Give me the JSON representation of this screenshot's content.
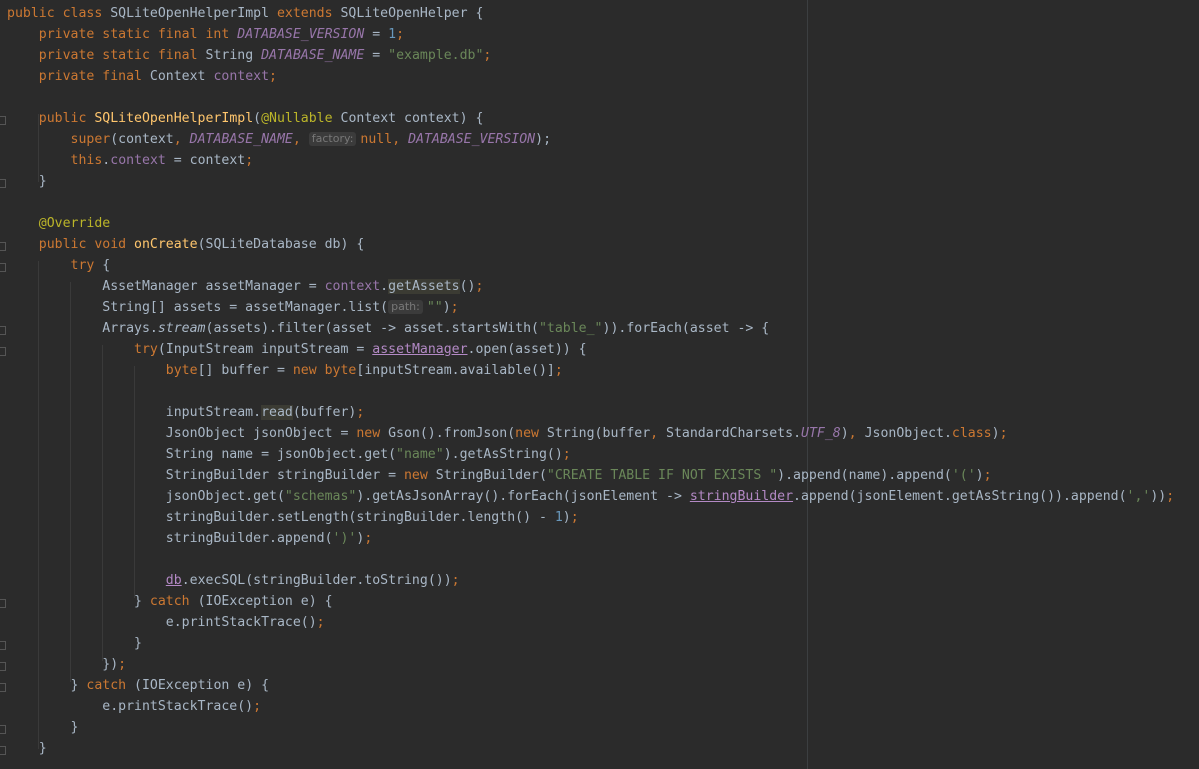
{
  "editor": {
    "lines": [
      [
        {
          "t": "public class ",
          "c": "kw"
        },
        {
          "t": "SQLiteOpenHelperImpl "
        },
        {
          "t": "extends ",
          "c": "kw"
        },
        {
          "t": "SQLiteOpenHelper {"
        }
      ],
      [
        {
          "t": "    "
        },
        {
          "t": "private static final int ",
          "c": "kw"
        },
        {
          "t": "DATABASE_VERSION",
          "c": "cst"
        },
        {
          "t": " = "
        },
        {
          "t": "1",
          "c": "num"
        },
        {
          "t": ";",
          "c": "kw"
        }
      ],
      [
        {
          "t": "    "
        },
        {
          "t": "private static final ",
          "c": "kw"
        },
        {
          "t": "String "
        },
        {
          "t": "DATABASE_NAME",
          "c": "cst"
        },
        {
          "t": " = "
        },
        {
          "t": "\"example.db\"",
          "c": "str"
        },
        {
          "t": ";",
          "c": "kw"
        }
      ],
      [
        {
          "t": "    "
        },
        {
          "t": "private final ",
          "c": "kw"
        },
        {
          "t": "Context "
        },
        {
          "t": "context",
          "c": "fld"
        },
        {
          "t": ";",
          "c": "kw"
        }
      ],
      [],
      [
        {
          "t": "    "
        },
        {
          "t": "public ",
          "c": "kw"
        },
        {
          "t": "SQLiteOpenHelperImpl",
          "c": "fn"
        },
        {
          "t": "("
        },
        {
          "t": "@Nullable ",
          "c": "ann"
        },
        {
          "t": "Context context) {"
        }
      ],
      [
        {
          "t": "        "
        },
        {
          "t": "super",
          "c": "kw"
        },
        {
          "t": "(context"
        },
        {
          "t": ", ",
          "c": "kw"
        },
        {
          "t": "DATABASE_NAME",
          "c": "cst"
        },
        {
          "t": ", ",
          "c": "kw"
        },
        {
          "t": "factory:",
          "c": "hint"
        },
        {
          "t": "null",
          "c": "kw"
        },
        {
          "t": ", ",
          "c": "kw"
        },
        {
          "t": "DATABASE_VERSION",
          "c": "cst"
        },
        {
          "t": ");"
        }
      ],
      [
        {
          "t": "        "
        },
        {
          "t": "this",
          "c": "kw"
        },
        {
          "t": "."
        },
        {
          "t": "context",
          "c": "fld"
        },
        {
          "t": " = context"
        },
        {
          "t": ";",
          "c": "kw"
        }
      ],
      [
        {
          "t": "    }"
        }
      ],
      [],
      [
        {
          "t": "    "
        },
        {
          "t": "@Override",
          "c": "ann"
        }
      ],
      [
        {
          "t": "    "
        },
        {
          "t": "public void ",
          "c": "kw"
        },
        {
          "t": "onCreate",
          "c": "fn"
        },
        {
          "t": "(SQLiteDatabase db) {"
        }
      ],
      [
        {
          "t": "        "
        },
        {
          "t": "try ",
          "c": "kw"
        },
        {
          "t": "{"
        }
      ],
      [
        {
          "t": "            AssetManager assetManager = "
        },
        {
          "t": "context",
          "c": "fld"
        },
        {
          "t": "."
        },
        {
          "t": "getAssets",
          "c": "hl"
        },
        {
          "t": "()"
        },
        {
          "t": ";",
          "c": "kw"
        }
      ],
      [
        {
          "t": "            String[] assets = assetManager.list("
        },
        {
          "t": "path:",
          "c": "hint"
        },
        {
          "t": "\"\"",
          "c": "str"
        },
        {
          "t": ")"
        },
        {
          "t": ";",
          "c": "kw"
        }
      ],
      [
        {
          "t": "            Arrays."
        },
        {
          "t": "stream",
          "c": "st"
        },
        {
          "t": "(assets).filter(asset -> asset.startsWith("
        },
        {
          "t": "\"table_\"",
          "c": "str"
        },
        {
          "t": ")).forEach(asset -> {"
        }
      ],
      [
        {
          "t": "                "
        },
        {
          "t": "try",
          "c": "kw"
        },
        {
          "t": "(InputStream inputStream = "
        },
        {
          "t": "assetManager",
          "c": "ul"
        },
        {
          "t": ".open(asset)) {"
        }
      ],
      [
        {
          "t": "                    "
        },
        {
          "t": "byte",
          "c": "kw"
        },
        {
          "t": "[] buffer = "
        },
        {
          "t": "new byte",
          "c": "kw"
        },
        {
          "t": "[inputStream.available()]"
        },
        {
          "t": ";",
          "c": "kw"
        }
      ],
      [],
      [
        {
          "t": "                    inputStream."
        },
        {
          "t": "read",
          "c": "hl"
        },
        {
          "t": "(buffer)"
        },
        {
          "t": ";",
          "c": "kw"
        }
      ],
      [
        {
          "t": "                    JsonObject jsonObject = "
        },
        {
          "t": "new ",
          "c": "kw"
        },
        {
          "t": "Gson().fromJson("
        },
        {
          "t": "new ",
          "c": "kw"
        },
        {
          "t": "String(buffer"
        },
        {
          "t": ", ",
          "c": "kw"
        },
        {
          "t": "StandardCharsets."
        },
        {
          "t": "UTF_8",
          "c": "cst"
        },
        {
          "t": ")"
        },
        {
          "t": ", ",
          "c": "kw"
        },
        {
          "t": "JsonObject."
        },
        {
          "t": "class",
          "c": "kw"
        },
        {
          "t": ")"
        },
        {
          "t": ";",
          "c": "kw"
        }
      ],
      [
        {
          "t": "                    String name = jsonObject.get("
        },
        {
          "t": "\"name\"",
          "c": "str"
        },
        {
          "t": ").getAsString()"
        },
        {
          "t": ";",
          "c": "kw"
        }
      ],
      [
        {
          "t": "                    StringBuilder stringBuilder = "
        },
        {
          "t": "new ",
          "c": "kw"
        },
        {
          "t": "StringBuilder("
        },
        {
          "t": "\"CREATE TABLE IF NOT EXISTS \"",
          "c": "str"
        },
        {
          "t": ").append(name).append("
        },
        {
          "t": "'('",
          "c": "str"
        },
        {
          "t": ")"
        },
        {
          "t": ";",
          "c": "kw"
        }
      ],
      [
        {
          "t": "                    jsonObject.get("
        },
        {
          "t": "\"schemas\"",
          "c": "str"
        },
        {
          "t": ").getAsJsonArray().forEach(jsonElement -> "
        },
        {
          "t": "stringBuilder",
          "c": "ul"
        },
        {
          "t": ".append(jsonElement.getAsString()).append("
        },
        {
          "t": "','",
          "c": "str"
        },
        {
          "t": "))"
        },
        {
          "t": ";",
          "c": "kw"
        }
      ],
      [
        {
          "t": "                    stringBuilder.setLength(stringBuilder.length() - "
        },
        {
          "t": "1",
          "c": "num"
        },
        {
          "t": ")"
        },
        {
          "t": ";",
          "c": "kw"
        }
      ],
      [
        {
          "t": "                    stringBuilder.append("
        },
        {
          "t": "')'",
          "c": "str"
        },
        {
          "t": ")"
        },
        {
          "t": ";",
          "c": "kw"
        }
      ],
      [],
      [
        {
          "t": "                    "
        },
        {
          "t": "db",
          "c": "ul"
        },
        {
          "t": ".execSQL(stringBuilder.toString())"
        },
        {
          "t": ";",
          "c": "kw"
        }
      ],
      [
        {
          "t": "                } "
        },
        {
          "t": "catch ",
          "c": "kw"
        },
        {
          "t": "(IOException e) {"
        }
      ],
      [
        {
          "t": "                    e.printStackTrace()"
        },
        {
          "t": ";",
          "c": "kw"
        }
      ],
      [
        {
          "t": "                }"
        }
      ],
      [
        {
          "t": "            })"
        },
        {
          "t": ";",
          "c": "kw"
        }
      ],
      [
        {
          "t": "        } "
        },
        {
          "t": "catch ",
          "c": "kw"
        },
        {
          "t": "(IOException e) {"
        }
      ],
      [
        {
          "t": "            e.printStackTrace()"
        },
        {
          "t": ";",
          "c": "kw"
        }
      ],
      [
        {
          "t": "        }"
        }
      ],
      [
        {
          "t": "    }"
        }
      ]
    ]
  }
}
